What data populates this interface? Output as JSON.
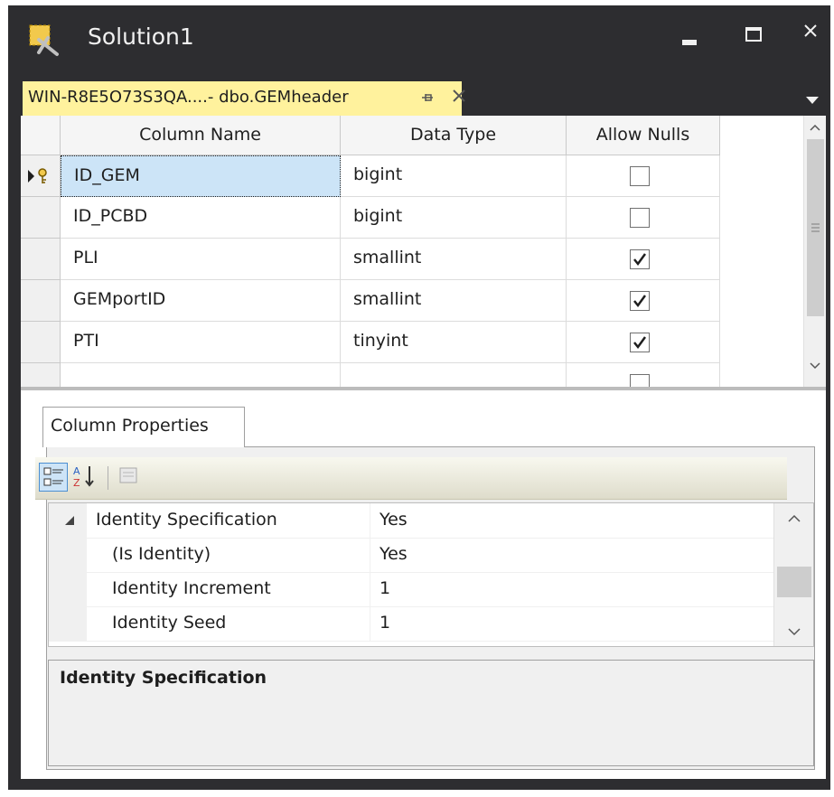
{
  "window": {
    "title": "Solution1",
    "minimize_icon": "minimize-icon",
    "maximize_icon": "maximize-icon",
    "close_icon": "close-icon"
  },
  "document_tab": {
    "label": "WIN-R8E5O73S3QA....- dbo.GEMheader",
    "pin_icon": "pin-icon",
    "close_icon": "close-icon"
  },
  "table_designer": {
    "headers": [
      "Column Name",
      "Data Type",
      "Allow Nulls"
    ],
    "rows": [
      {
        "name": "ID_GEM",
        "type": "bigint",
        "allow_nulls": false,
        "primary_key": true
      },
      {
        "name": "ID_PCBD",
        "type": "bigint",
        "allow_nulls": false
      },
      {
        "name": "PLI",
        "type": "smallint",
        "allow_nulls": true
      },
      {
        "name": "GEMportID",
        "type": "smallint",
        "allow_nulls": true
      },
      {
        "name": "PTI",
        "type": "tinyint",
        "allow_nulls": true
      }
    ]
  },
  "column_properties": {
    "tab_label": "Column Properties",
    "toolbar": [
      "categorized-icon",
      "alphabetical-sort-icon",
      "property-pages-icon"
    ],
    "rows": [
      {
        "name": "Identity Specification",
        "value": "Yes",
        "category": true
      },
      {
        "name": "(Is Identity)",
        "value": "Yes"
      },
      {
        "name": "Identity Increment",
        "value": "1"
      },
      {
        "name": "Identity Seed",
        "value": "1"
      }
    ],
    "description_title": "Identity Specification"
  },
  "colors": {
    "chrome": "#2d2d30",
    "tab_active": "#fff29d",
    "selection": "#cce4f7"
  }
}
